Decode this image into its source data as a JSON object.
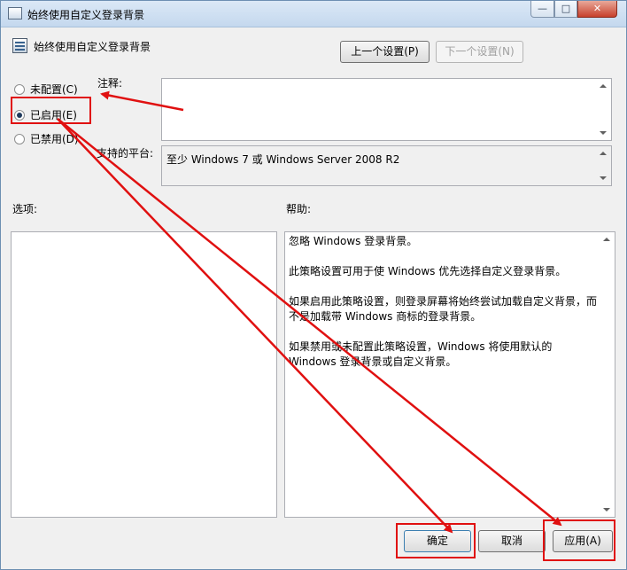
{
  "window": {
    "title": "始终使用自定义登录背景",
    "controls": {
      "minimize": "—",
      "maximize": "□",
      "close": "✕"
    }
  },
  "header": {
    "title": "始终使用自定义登录背景",
    "prev_button": "上一个设置(P)",
    "next_button": "下一个设置(N)"
  },
  "options": {
    "not_configured": "未配置(C)",
    "enabled": "已启用(E)",
    "disabled": "已禁用(D)",
    "selected": "enabled"
  },
  "comment": {
    "label": "注释:",
    "value": ""
  },
  "supported": {
    "label": "支持的平台:",
    "value": "至少 Windows 7 或 Windows Server 2008 R2"
  },
  "options_section": {
    "label": "选项:"
  },
  "help_section": {
    "label": "帮助:",
    "paragraphs": [
      "忽略 Windows 登录背景。",
      "此策略设置可用于使 Windows 优先选择自定义登录背景。",
      "如果启用此策略设置，则登录屏幕将始终尝试加载自定义背景，而不是加载带 Windows 商标的登录背景。",
      "如果禁用或未配置此策略设置，Windows 将使用默认的 Windows 登录背景或自定义背景。"
    ]
  },
  "footer": {
    "ok_button": "确定",
    "cancel_button": "取消",
    "apply_button": "应用(A)"
  },
  "annotations": {
    "highlight_color": "#e01010"
  }
}
